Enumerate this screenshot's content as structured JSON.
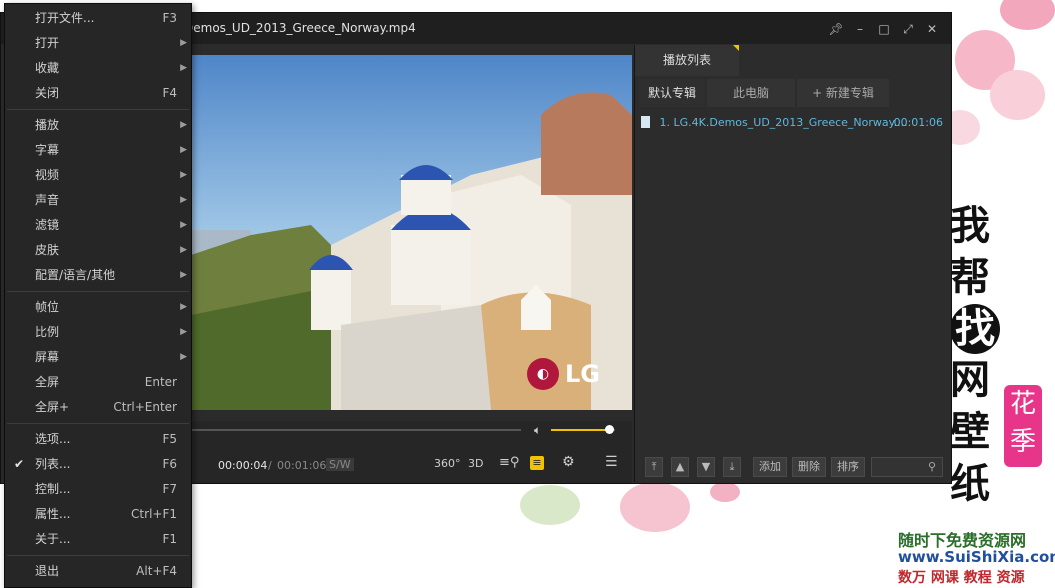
{
  "window": {
    "title": "Demos_UD_2013_Greece_Norway.mp4"
  },
  "menu": {
    "items": [
      {
        "label": "打开文件...",
        "shortcut": "F3",
        "submenu": false
      },
      {
        "label": "打开",
        "shortcut": "",
        "submenu": true
      },
      {
        "label": "收藏",
        "shortcut": "",
        "submenu": true
      },
      {
        "label": "关闭",
        "shortcut": "F4",
        "submenu": false
      },
      {
        "label": "播放",
        "shortcut": "",
        "submenu": true
      },
      {
        "label": "字幕",
        "shortcut": "",
        "submenu": true
      },
      {
        "label": "视频",
        "shortcut": "",
        "submenu": true
      },
      {
        "label": "声音",
        "shortcut": "",
        "submenu": true
      },
      {
        "label": "滤镜",
        "shortcut": "",
        "submenu": true
      },
      {
        "label": "皮肤",
        "shortcut": "",
        "submenu": true
      },
      {
        "label": "配置/语言/其他",
        "shortcut": "",
        "submenu": true
      },
      {
        "label": "帧位",
        "shortcut": "",
        "submenu": true
      },
      {
        "label": "比例",
        "shortcut": "",
        "submenu": true
      },
      {
        "label": "屏幕",
        "shortcut": "",
        "submenu": true
      },
      {
        "label": "全屏",
        "shortcut": "Enter",
        "submenu": false
      },
      {
        "label": "全屏+",
        "shortcut": "Ctrl+Enter",
        "submenu": false
      },
      {
        "label": "选项...",
        "shortcut": "F5",
        "submenu": false
      },
      {
        "label": "列表...",
        "shortcut": "F6",
        "submenu": false,
        "checked": true
      },
      {
        "label": "控制...",
        "shortcut": "F7",
        "submenu": false
      },
      {
        "label": "属性...",
        "shortcut": "Ctrl+F1",
        "submenu": false
      },
      {
        "label": "关于...",
        "shortcut": "F1",
        "submenu": false
      },
      {
        "label": "退出",
        "shortcut": "Alt+F4",
        "submenu": false
      }
    ]
  },
  "video": {
    "logo_text": "LG"
  },
  "controls": {
    "current_time": "00:00:04",
    "separator": "/",
    "total_time": "00:01:06",
    "sw_label": "S/W",
    "btn_360": "360°",
    "btn_3d": "3D",
    "volume": 0.9
  },
  "playlist": {
    "tab_label": "播放列表",
    "subtabs": [
      "默认专辑",
      "此电脑",
      "+ 新建专辑"
    ],
    "items": [
      {
        "name": "1. LG.4K.Demos_UD_2013_Greece_Norway....",
        "duration": "00:01:06"
      }
    ],
    "buttons": {
      "add": "添加",
      "delete": "删除",
      "sort": "排序"
    }
  },
  "desktop": {
    "calligraphy": [
      "我",
      "帮",
      "找",
      "网",
      "壁",
      "纸"
    ],
    "stamp": [
      "花",
      "季"
    ],
    "watermark": {
      "line1": "随时下免费资源网",
      "line2": "www.SuiShiXia.com",
      "line3": "数万 网课 教程 资源"
    }
  },
  "colors": {
    "accent": "#f2c100",
    "link": "#5fb8e0",
    "panel_bg": "#2c2c2c"
  }
}
